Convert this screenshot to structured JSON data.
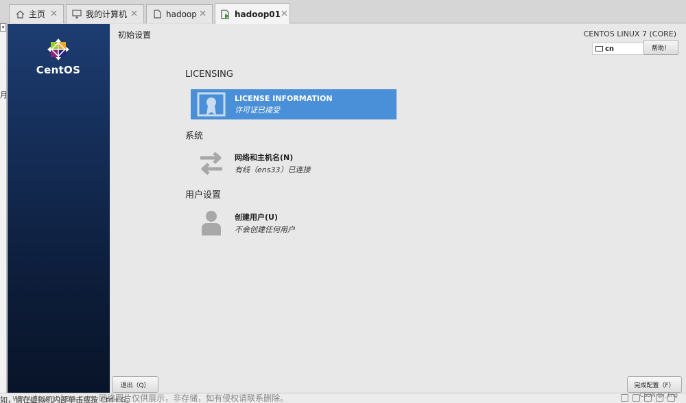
{
  "tabs": [
    {
      "label": "主页",
      "icon": "home-icon",
      "active": false
    },
    {
      "label": "我的计算机",
      "icon": "computer-icon",
      "active": false
    },
    {
      "label": "hadoop",
      "icon": "vm-page-icon",
      "active": false
    },
    {
      "label": "hadoop01",
      "icon": "vm-running-icon",
      "active": true
    }
  ],
  "tab_close": "✕",
  "vm": {
    "logo_text": "CentOS",
    "page_title": "初始设置",
    "os_name": "CENTOS LINUX 7 (CORE)",
    "keyboard_layout": "cn",
    "help_label": "帮助！",
    "sections": [
      {
        "title": "LICENSING",
        "spokes": [
          {
            "title": "LICENSE INFORMATION",
            "status": "许可证已接受",
            "icon": "license-icon",
            "selected": true
          }
        ]
      },
      {
        "title": "系统",
        "spokes": [
          {
            "title": "网络和主机名(N)",
            "status": "有线（ens33）已连接",
            "icon": "network-arrows-icon",
            "selected": false
          }
        ]
      },
      {
        "title": "用户设置",
        "spokes": [
          {
            "title": "创建用户(U)",
            "status": "不会创建任何用户",
            "icon": "user-icon",
            "selected": false
          }
        ]
      }
    ],
    "quit_label": "退出（Q）",
    "finish_label": "完成配置（F）"
  },
  "host": {
    "left_cut_char": "月",
    "bottom_hint": "如，请在虚拟机内部单击或按 Ctrl+G。",
    "watermark": "www.toymoban.com 网络图片仅供展示，非存储，如有侵权请联系删除。",
    "csdn": "CSDN @r_ling"
  },
  "colors": {
    "selected_spoke": "#4a90d9",
    "sidebar_top": "#1d3d72",
    "sidebar_bottom": "#081428"
  }
}
